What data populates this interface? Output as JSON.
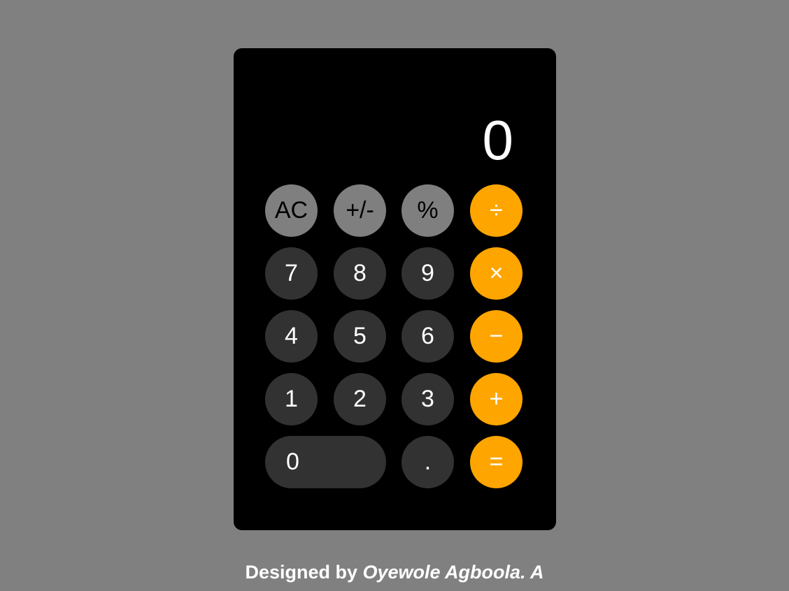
{
  "display": {
    "value": "0"
  },
  "keys": {
    "clear": "AC",
    "sign": "+/-",
    "percent": "%",
    "divide": "÷",
    "seven": "7",
    "eight": "8",
    "nine": "9",
    "multiply": "×",
    "four": "4",
    "five": "5",
    "six": "6",
    "subtract": "−",
    "one": "1",
    "two": "2",
    "three": "3",
    "add": "+",
    "zero": "0",
    "decimal": ".",
    "equals": "="
  },
  "footer": {
    "prefix": "Designed by",
    "author": "Oyewole Agboola. A"
  },
  "colors": {
    "page_background": "#808080",
    "calculator_background": "#000000",
    "function_key": "#7f7f7f",
    "number_key": "#333232",
    "operator_key": "#ffa500",
    "text_light": "#ffffff",
    "text_dark": "#000000"
  }
}
